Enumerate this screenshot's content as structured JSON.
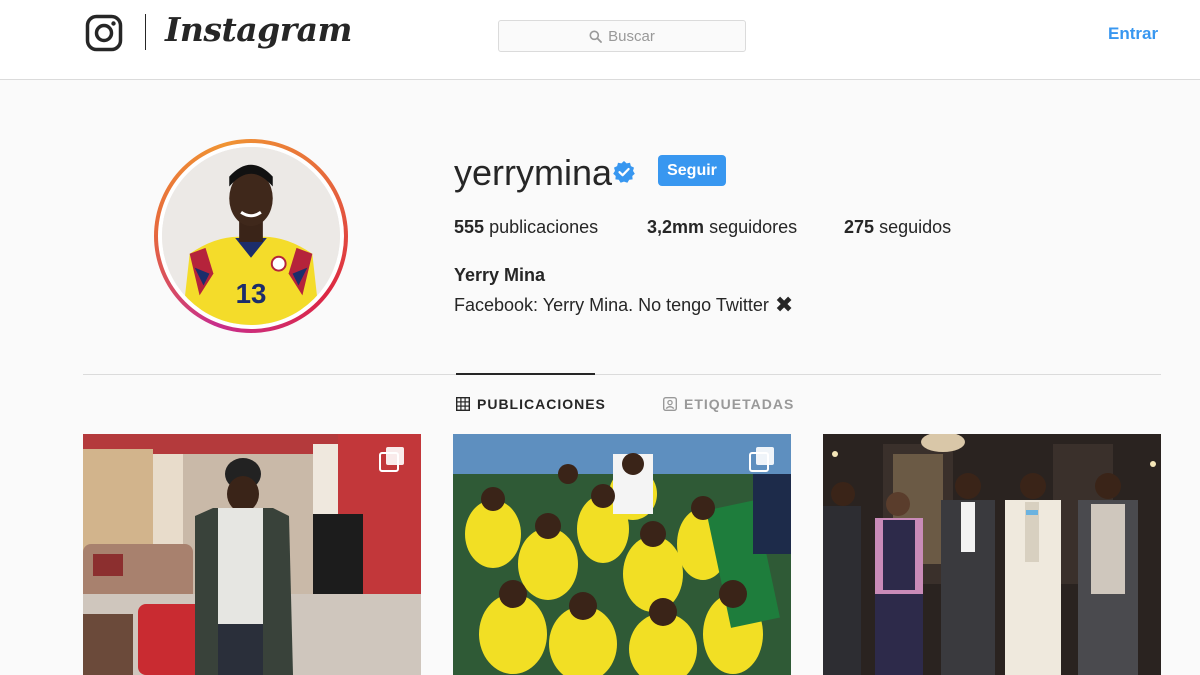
{
  "header": {
    "wordmark": "Instagram",
    "search_placeholder": "Buscar",
    "login_label": "Entrar"
  },
  "profile": {
    "username": "yerrymina",
    "verified": true,
    "follow_label": "Seguir",
    "stats": [
      {
        "value": "555",
        "label": "publicaciones"
      },
      {
        "value": "3,2mm",
        "label": "seguidores"
      },
      {
        "value": "275",
        "label": "seguidos"
      }
    ],
    "full_name": "Yerry Mina",
    "bio": "Facebook: Yerry Mina. No tengo Twitter",
    "bio_emoji": "✖"
  },
  "tabs": [
    {
      "label": "PUBLICACIONES",
      "icon": "grid-icon",
      "active": true
    },
    {
      "label": "ETIQUETADAS",
      "icon": "tagged-icon",
      "active": false
    }
  ],
  "posts": [
    {
      "icon": "multi-photo-icon",
      "scene": "man-in-living-room"
    },
    {
      "icon": "multi-photo-icon",
      "scene": "kids-in-yellow-jerseys"
    },
    {
      "scene": "men-in-suits-at-event"
    }
  ],
  "colors": {
    "accent": "#3897f0",
    "text": "#262626",
    "muted": "#999999",
    "border": "#dbdbdb",
    "background": "#fafafa"
  }
}
